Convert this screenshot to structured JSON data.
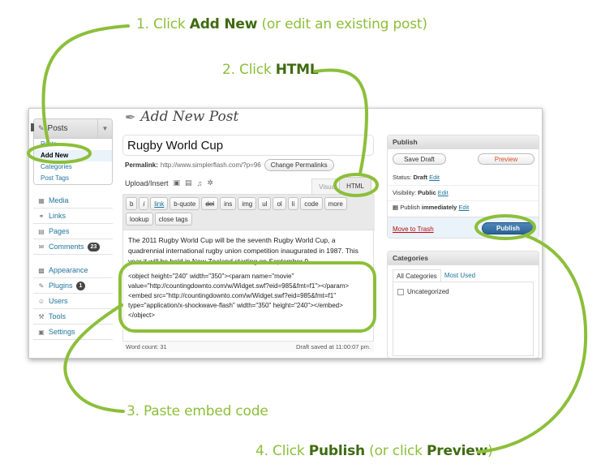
{
  "callouts": {
    "step1": {
      "num": "1. Click ",
      "action": "Add New",
      "rest": " (or edit an existing post)"
    },
    "step2": {
      "num": "2. Click ",
      "action": "HTML"
    },
    "step3": {
      "num": "3. Paste embed code"
    },
    "step4": {
      "num": "4. Click ",
      "action": "Publish",
      "mid": " (or click ",
      "action2": "Preview",
      "end": ")"
    }
  },
  "colors": {
    "callout_green": "#8cbf3a",
    "callout_dark": "#3f6b10",
    "link": "#21759b",
    "publish": "#2a6394"
  },
  "sidebar": {
    "posts_head": "Posts",
    "posts_sub": [
      "Posts",
      "Add New",
      "Categories",
      "Post Tags"
    ],
    "items_top": [
      {
        "icon": "media-icon",
        "glyph": "▦",
        "label": "Media"
      },
      {
        "icon": "links-icon",
        "glyph": "⚭",
        "label": "Links"
      },
      {
        "icon": "pages-icon",
        "glyph": "▤",
        "label": "Pages"
      },
      {
        "icon": "comments-icon",
        "glyph": "✉",
        "label": "Comments",
        "badge": "23"
      }
    ],
    "items_bottom": [
      {
        "icon": "appearance-icon",
        "glyph": "▩",
        "label": "Appearance"
      },
      {
        "icon": "plugins-icon",
        "glyph": "✎",
        "label": "Plugins",
        "badge": "1"
      },
      {
        "icon": "users-icon",
        "glyph": "☺",
        "label": "Users"
      },
      {
        "icon": "tools-icon",
        "glyph": "⚒",
        "label": "Tools"
      },
      {
        "icon": "settings-icon",
        "glyph": "▣",
        "label": "Settings"
      }
    ]
  },
  "page": {
    "title": "Add New Post",
    "post_title": "Rugby World Cup",
    "permalink_label": "Permalink:",
    "permalink_url": "http://www.simplerflash.com/?p=96",
    "change_permalinks": "Change Permalinks",
    "upload_insert": "Upload/Insert",
    "tab_visual": "Visual",
    "tab_html": "HTML"
  },
  "toolbar": [
    "b",
    "i",
    "link",
    "b-quote",
    "del",
    "ins",
    "img",
    "ul",
    "ol",
    "li",
    "code",
    "more",
    "lookup",
    "close tags"
  ],
  "content": {
    "paragraph": "The 2011 Rugby World Cup will be the seventh Rugby World Cup, a quadrennial international rugby union competition inaugurated in 1987. This year it will be held in New Zealand starting on September 9.",
    "embed": "<object height=\"240\" width=\"350\"><param name=\"movie\" value=\"http://countingdownto.com/w/Widget.swf?eid=985&fmt=f1\"></param><embed src=\"http://countingdownto.com/w/Widget.swf?eid=985&fmt=f1\" type=\"application/x-shockwave-flash\" width=\"350\" height=\"240\"></embed></object>"
  },
  "editor_footer": {
    "word_count": "Word count: 31",
    "draft_saved": "Draft saved at 11:00:07 pm."
  },
  "publish": {
    "title": "Publish",
    "save_draft": "Save Draft",
    "preview": "Preview",
    "status_label": "Status:",
    "status_value": "Draft",
    "visibility_label": "Visibility:",
    "visibility_value": "Public",
    "publish_label": "Publish",
    "publish_value": "immediately",
    "edit": "Edit",
    "move_to_trash": "Move to Trash",
    "publish_button": "Publish"
  },
  "categories": {
    "title": "Categories",
    "tab_all": "All Categories",
    "tab_used": "Most Used",
    "items": [
      "Uncategorized"
    ]
  }
}
